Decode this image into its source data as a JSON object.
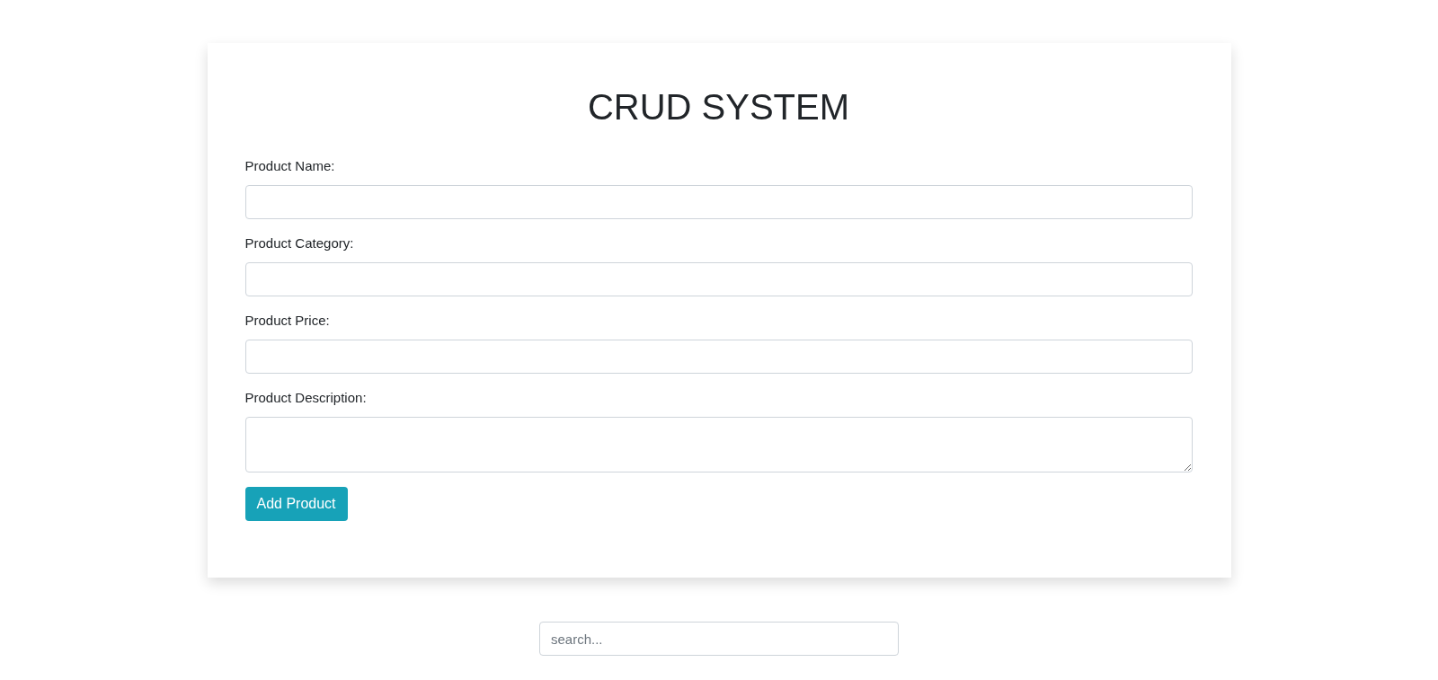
{
  "form": {
    "title": "CRUD SYSTEM",
    "fields": [
      {
        "label": "Product Name:",
        "kind": "input"
      },
      {
        "label": "Product Category:",
        "kind": "input"
      },
      {
        "label": "Product Price:",
        "kind": "input"
      },
      {
        "label": "Product Description:",
        "kind": "textarea"
      }
    ],
    "submit_button": "Add Product"
  },
  "search": {
    "placeholder": "search..."
  }
}
